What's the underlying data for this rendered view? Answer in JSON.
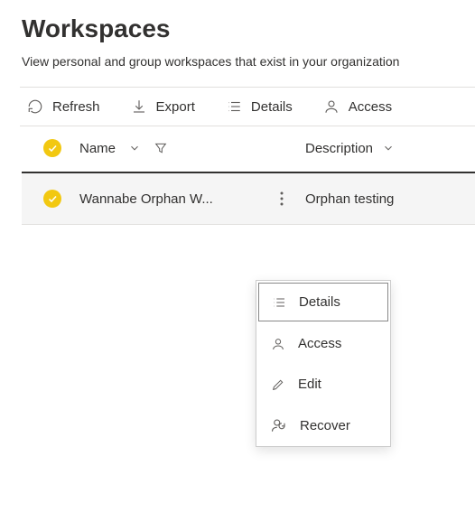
{
  "page": {
    "title": "Workspaces",
    "subtitle": "View personal and group workspaces that exist in your organization"
  },
  "toolbar": {
    "refresh": "Refresh",
    "export": "Export",
    "details": "Details",
    "access": "Access"
  },
  "columns": {
    "name": "Name",
    "description": "Description"
  },
  "rows": [
    {
      "name": "Wannabe Orphan W...",
      "description": "Orphan testing"
    }
  ],
  "context_menu": {
    "details": "Details",
    "access": "Access",
    "edit": "Edit",
    "recover": "Recover"
  },
  "colors": {
    "accent": "#f2c811"
  }
}
